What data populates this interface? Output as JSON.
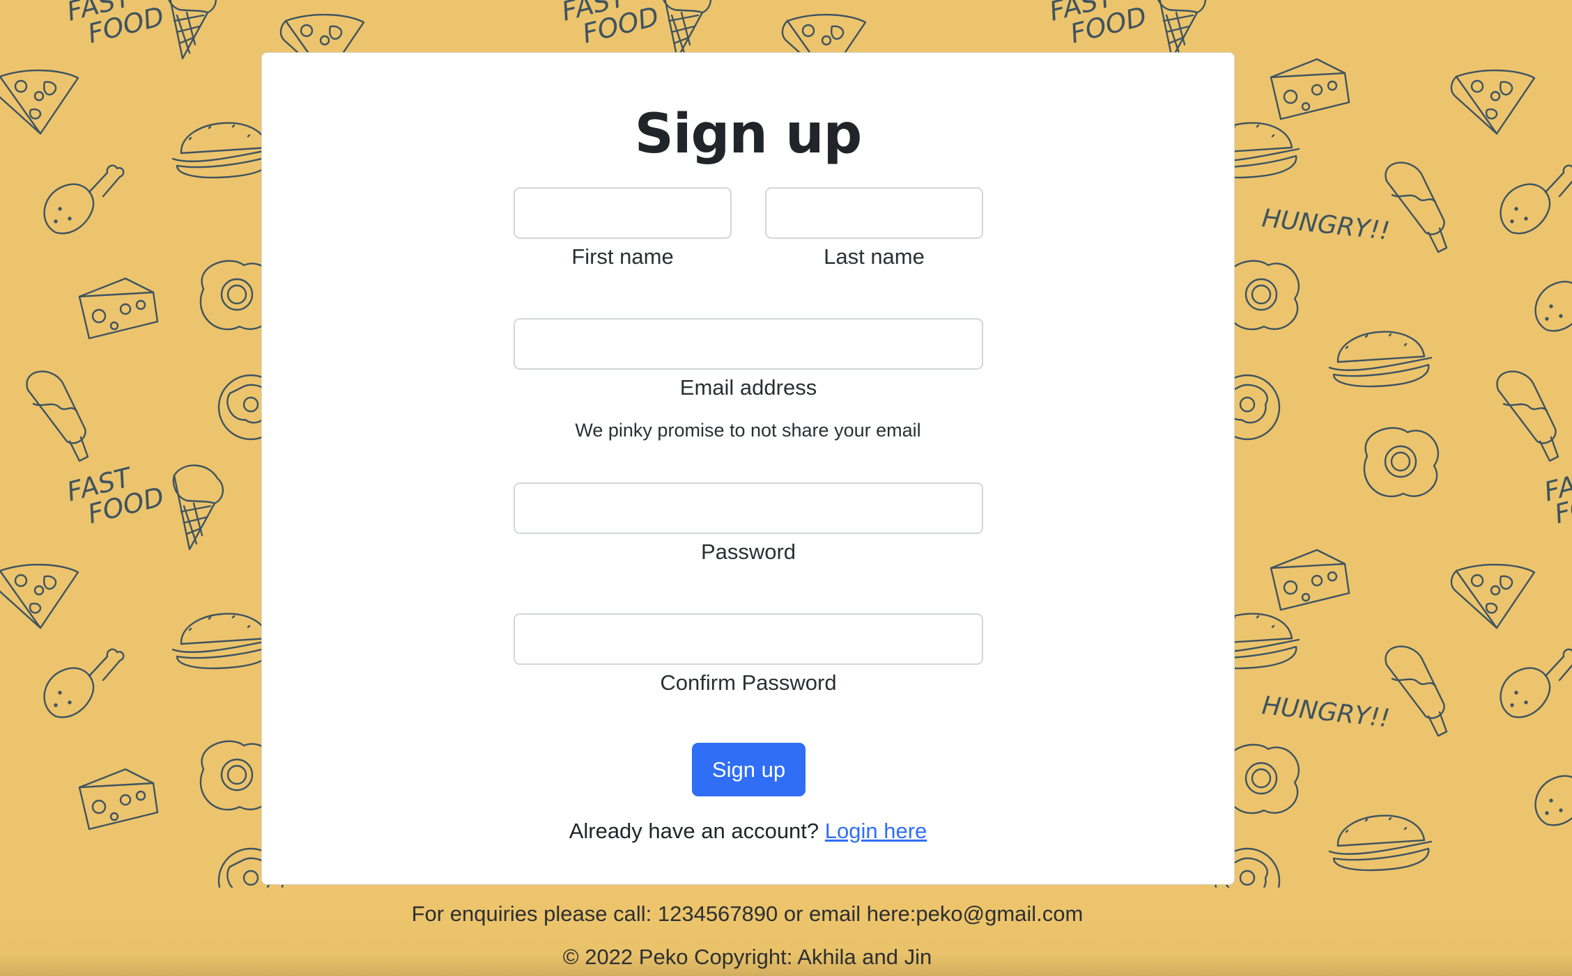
{
  "signup": {
    "title": "Sign up",
    "first_name_label": "First name",
    "last_name_label": "Last name",
    "email_label": "Email address",
    "email_help": "We pinky promise to not share your email",
    "password_label": "Password",
    "confirm_password_label": "Confirm Password",
    "submit_label": "Sign up",
    "login_prompt": "Already have an account?",
    "login_link": "Login here"
  },
  "footer": {
    "contact": "For enquiries please call: 1234567890 or email here:peko@gmail.com",
    "copyright": "© 2022 Peko Copyright: Akhila and Jin"
  },
  "background": {
    "pattern_text_1": "FAST FOOD",
    "pattern_text_2": "HUNGRY!!",
    "color": "#ecc46d"
  },
  "colors": {
    "accent": "#2f6ef5",
    "doodle_stroke": "#3e5360"
  }
}
